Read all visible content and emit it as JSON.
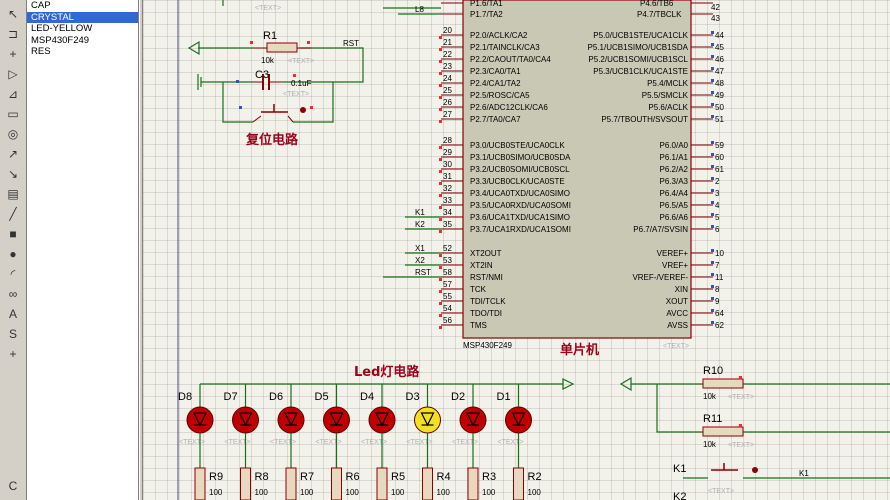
{
  "devices": [
    "CAP",
    "CRYSTAL",
    "LED-YELLOW",
    "MSP430F249",
    "RES"
  ],
  "selected_device": "CRYSTAL",
  "chip": {
    "name": "MSP430F249",
    "text_tag": "<TEXT>",
    "title": "单片机",
    "top_pins_left": [
      {
        "label": "P1.6/TA1",
        "num": ""
      },
      {
        "label": "P1.7/TA2",
        "num": ""
      }
    ],
    "top_pins_right": [
      {
        "label": "P4.6/TB6",
        "num": "42"
      },
      {
        "label": "P4.7/TBCLK",
        "num": "43"
      }
    ],
    "left_p2": [
      {
        "num": "20",
        "label": "P2.0/ACLK/CA2"
      },
      {
        "num": "21",
        "label": "P2.1/TAINCLK/CA3"
      },
      {
        "num": "22",
        "label": "P2.2/CAOUT/TA0/CA4"
      },
      {
        "num": "23",
        "label": "P2.3/CA0/TA1"
      },
      {
        "num": "24",
        "label": "P2.4/CA1/TA2"
      },
      {
        "num": "25",
        "label": "P2.5/ROSC/CA5"
      },
      {
        "num": "26",
        "label": "P2.6/ADC12CLK/CA6"
      },
      {
        "num": "27",
        "label": "P2.7/TA0/CA7"
      }
    ],
    "left_p3": [
      {
        "num": "28",
        "label": "P3.0/UCB0STE/UCA0CLK"
      },
      {
        "num": "29",
        "label": "P3.1/UCB0SIMO/UCB0SDA"
      },
      {
        "num": "30",
        "label": "P3.2/UCB0SOMI/UCB0SCL"
      },
      {
        "num": "31",
        "label": "P3.3/UCB0CLK/UCA0STE"
      },
      {
        "num": "32",
        "label": "P3.4/UCA0TXD/UCA0SIMO"
      },
      {
        "num": "33",
        "label": "P3.5/UCA0RXD/UCA0SOMI"
      },
      {
        "num": "34",
        "label": "P3.6/UCA1TXD/UCA1SIMO"
      },
      {
        "num": "35",
        "label": "P3.7/UCA1RXD/UCA1SOMI"
      }
    ],
    "left_misc": [
      {
        "num": "52",
        "label": "XT2OUT"
      },
      {
        "num": "53",
        "label": "XT2IN"
      },
      {
        "num": "58",
        "label": "RST/NMI"
      },
      {
        "num": "57",
        "label": "TCK"
      },
      {
        "num": "55",
        "label": "TDI/TCLK"
      },
      {
        "num": "54",
        "label": "TDO/TDI"
      },
      {
        "num": "56",
        "label": "TMS"
      }
    ],
    "right_p5": [
      {
        "num": "44",
        "label": "P5.0/UCB1STE/UCA1CLK"
      },
      {
        "num": "45",
        "label": "P5.1/UCB1SIMO/UCB1SDA"
      },
      {
        "num": "46",
        "label": "P5.2/UCB1SOMI/UCB1SCL"
      },
      {
        "num": "47",
        "label": "P5.3/UCB1CLK/UCA1STE"
      },
      {
        "num": "48",
        "label": "P5.4/MCLK"
      },
      {
        "num": "49",
        "label": "P5.5/SMCLK"
      },
      {
        "num": "50",
        "label": "P5.6/ACLK"
      },
      {
        "num": "51",
        "label": "P5.7/TBOUTH/SVSOUT"
      }
    ],
    "right_p6": [
      {
        "num": "59",
        "label": "P6.0/A0"
      },
      {
        "num": "60",
        "label": "P6.1/A1"
      },
      {
        "num": "61",
        "label": "P6.2/A2"
      },
      {
        "num": "2",
        "label": "P6.3/A3"
      },
      {
        "num": "3",
        "label": "P6.4/A4"
      },
      {
        "num": "4",
        "label": "P6.5/A5"
      },
      {
        "num": "5",
        "label": "P6.6/A6"
      },
      {
        "num": "6",
        "label": "P6.7/A7/SVSIN"
      }
    ],
    "right_misc": [
      {
        "num": "10",
        "label": "VEREF+"
      },
      {
        "num": "7",
        "label": "VREF+"
      },
      {
        "num": "11",
        "label": "VREF-/VEREF-"
      },
      {
        "num": "8",
        "label": "XIN"
      },
      {
        "num": "9",
        "label": "XOUT"
      },
      {
        "num": "64",
        "label": "AVCC"
      },
      {
        "num": "62",
        "label": "AVSS"
      }
    ]
  },
  "nets": {
    "l8": "L8",
    "k1": "K1",
    "k2": "K2",
    "x1": "X1",
    "x2": "X2",
    "rst": "RST",
    "rst_left": "RST",
    "k1_right": "K1"
  },
  "reset": {
    "title": "复位电路",
    "r1_ref": "R1",
    "r1_val": "10k",
    "c3_ref": "C3",
    "c3_val": "0.1uF",
    "text_tag": "<TEXT>"
  },
  "led": {
    "title": "Led灯电路",
    "diodes": [
      "D8",
      "D7",
      "D6",
      "D5",
      "D4",
      "D3",
      "D2",
      "D1"
    ],
    "resistors": [
      "R9",
      "R8",
      "R7",
      "R6",
      "R5",
      "R4",
      "R3",
      "R2"
    ],
    "res_val": "100",
    "text_tag": "<TEXT>"
  },
  "keys": {
    "r10_ref": "R10",
    "r10_val": "10k",
    "r11_ref": "R11",
    "r11_val": "10k",
    "k1_ref": "K1",
    "k2_ref": "K2",
    "text_tag": "<TEXT>"
  },
  "colors": {
    "wire": "#1a6f1a",
    "component": "#8b0000",
    "chip_fill": "#c8c8b4",
    "led_lit": "#f3e024",
    "led_off": "#c00000"
  }
}
